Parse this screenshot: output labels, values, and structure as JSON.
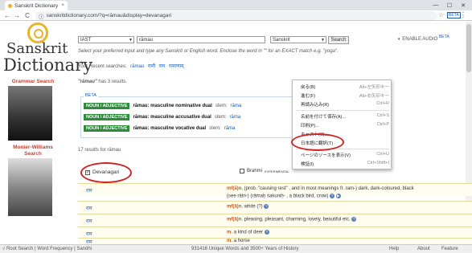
{
  "browser": {
    "tab_title": "Sanskrit Dictionary",
    "tab_close": "×",
    "url": "sanskritdictionary.com/?q=rāmau&display=devanagari",
    "back": "←",
    "forward": "→",
    "reload": "C",
    "minimize": "—",
    "maximize": "☐",
    "close": "✕",
    "star": "☆",
    "menu": "⋮",
    "profile": "BETA"
  },
  "site": {
    "logo_line1": "Sanskrit",
    "logo_line2": "Dictionary",
    "input_scheme": "IAST",
    "query": "rāmau",
    "output_scheme": "Sanskrit",
    "search_label": "Search",
    "hint": "Select your preferred input and type any Sanskrit or English word. Enclose the word in \"\" for an EXACT match e.g. \"yoga\".",
    "recent_label": "Your Recent searches:",
    "recent": [
      "rāmau",
      "रामौ",
      "राम",
      "रामाणाम्"
    ],
    "audio_label": "ENABLE AUDIO",
    "audio_beta": "BETA"
  },
  "sidebar": {
    "grammar_search": "Grammar Search",
    "mw_search_line1": "Monier-Williams",
    "mw_search_line2": "Search"
  },
  "results": {
    "count_word": "\"rāmau\"",
    "count_text": "has 3 results.",
    "beta_label": "BETA",
    "rows": [
      {
        "tag": "NOUN / ADJECTIVE",
        "word": "rāmau: masculine nominative dual",
        "stem_label": "stem:",
        "stem": "rāma"
      },
      {
        "tag": "NOUN / ADJECTIVE",
        "word": "rāmau: masculine accusative dual",
        "stem_label": "stem:",
        "stem": "rāma"
      },
      {
        "tag": "NOUN / ADJECTIVE",
        "word": "rāmau: masculine vocative dual",
        "stem_label": "stem:",
        "stem": "rāma"
      }
    ],
    "results_for": "17 results for rāmau",
    "devanagari_label": "Devanagari",
    "brahmi_label": "Brahmi",
    "brahmi_exp": "EXPERIMENTAL"
  },
  "entries": [
    {
      "dev": "राम",
      "gender": "mf(ā)n.",
      "meaning": "(prob. \"causing rest\" , and in most meanings fr. ram-) dark, dark-coloured, black"
    },
    {
      "dev": "राम",
      "gender": "",
      "meaning": "(see rātri-) (rāmaḥ śakuniḥ- , a black bird, crow)"
    },
    {
      "dev": "राम",
      "gender": "mf(ā)n.",
      "meaning": "white (?)"
    },
    {
      "dev": "राम",
      "gender": "mf(ā)n.",
      "meaning": "pleasing, pleasant, charming, lovely, beautiful etc."
    },
    {
      "dev": "राम",
      "gender": "m.",
      "meaning": "a kind of deer"
    },
    {
      "dev": "राम",
      "gender": "m.",
      "meaning": "a horse"
    }
  ],
  "context_menu": [
    {
      "label": "戻る(B)",
      "key": "Alt+左矢印キー"
    },
    {
      "label": "進む(F)",
      "key": "Alt+右矢印キー"
    },
    {
      "label": "再読み込み(R)",
      "key": "Ctrl+R"
    },
    {
      "label": "名前を付けて保存(A)...",
      "key": "Ctrl+S"
    },
    {
      "label": "印刷(P)...",
      "key": "Ctrl+P"
    },
    {
      "label": "キャスト(C)...",
      "key": ""
    },
    {
      "label": "日本語に翻訳(T)",
      "key": ""
    },
    {
      "label": "ページのソースを表示(V)",
      "key": "Ctrl+U"
    },
    {
      "label": "検証(I)",
      "key": "Ctrl+Shift+I"
    }
  ],
  "status": {
    "left": "√ Root Search | Word Frequency | Sandhi",
    "center": "931416 Unique Words and 3500+ Years of History",
    "help": "Help",
    "about": "About",
    "feature": "Feature"
  },
  "colors": {
    "accent_red": "#d02525",
    "noun_pill": "#2e8b3e",
    "link_blue": "#1a5fb4",
    "logo_gold": "#e9b42c"
  }
}
